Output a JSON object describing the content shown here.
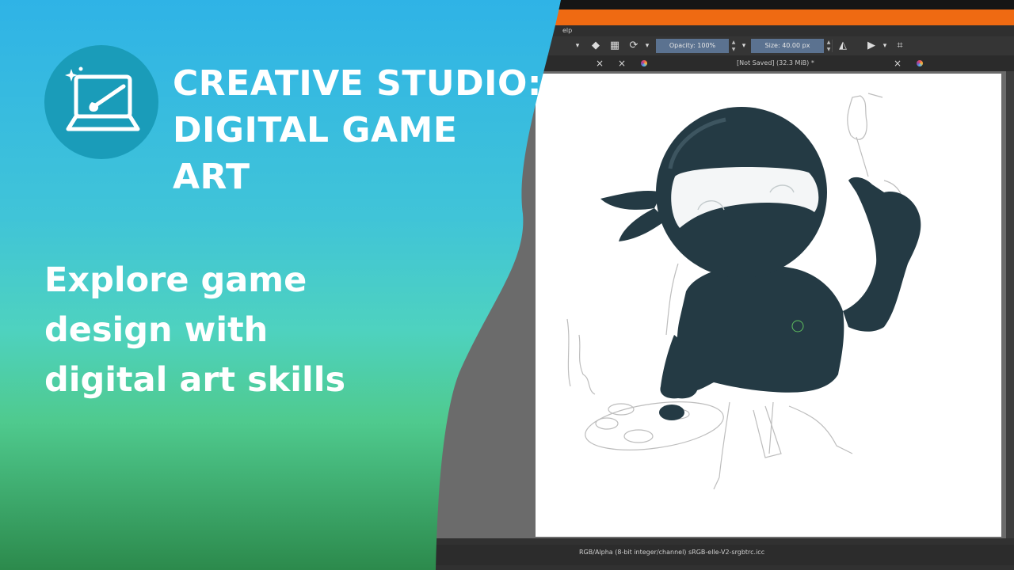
{
  "banner": {
    "title_lines": [
      "CREATIVE STUDIO:",
      "DIGITAL GAME",
      "ART"
    ],
    "subtitle_lines": [
      "Explore game",
      "design with",
      "digital art skills"
    ],
    "logo_icon": "laptop-paintbrush-icon",
    "colors": {
      "gradient_top": "#35b4e5",
      "gradient_mid": "#4fd3c4",
      "gradient_bottom": "#2f8f4e",
      "logo_circle": "#1a9cb9",
      "text": "#ffffff"
    }
  },
  "app": {
    "menu_fragment": "elp",
    "toolbar": {
      "opacity_label": "Opacity: 100%",
      "size_label": "Size: 40.00 px"
    },
    "document_tab": {
      "title": "[Not Saved]  (32.3 MiB) *"
    },
    "status": {
      "color_profile": "RGB/Alpha (8-bit integer/channel)  sRGB-elle-V2-srgbtrc.icc"
    },
    "colors": {
      "accent_orange": "#ef6a12",
      "field_blue": "#5b7290",
      "ninja": "#243a44"
    }
  }
}
